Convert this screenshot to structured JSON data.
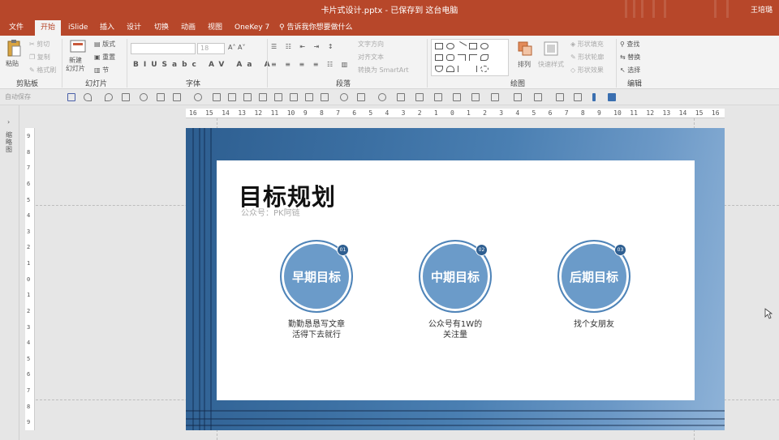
{
  "window": {
    "title": "卡片式设计.pptx - 已保存到 这台电脑",
    "user": "王培璐"
  },
  "tabs": [
    "文件",
    "开始",
    "iSlide",
    "插入",
    "设计",
    "切换",
    "动画",
    "视图",
    "OneKey 7"
  ],
  "active_tab": "开始",
  "tell_me": "告诉我你想要做什么",
  "ribbon": {
    "clipboard": {
      "label": "剪贴板",
      "paste": "粘贴",
      "cut": "剪切",
      "copy": "复制",
      "format_painter": "格式刷"
    },
    "slides": {
      "label": "幻灯片",
      "new_slide": "新建\n幻灯片",
      "layout": "版式",
      "reset": "重置",
      "section": "节"
    },
    "font": {
      "label": "字体",
      "size": "18"
    },
    "paragraph": {
      "label": "段落",
      "text_direction": "文字方向",
      "align_text": "对齐文本",
      "smartart": "转换为 SmartArt"
    },
    "drawing": {
      "label": "绘图",
      "arrange": "排列",
      "quick_styles": "快速样式",
      "shape_fill": "形状填充",
      "shape_outline": "形状轮廓",
      "shape_effects": "形状效果"
    },
    "editing": {
      "label": "编辑",
      "find": "查找",
      "replace": "替换",
      "select": "选择"
    }
  },
  "qat": {
    "autosave": "自动保存"
  },
  "thumbnail_pane": {
    "label": "缩略图"
  },
  "ruler": {
    "h_ticks": [
      "16",
      "15",
      "14",
      "13",
      "12",
      "11",
      "10",
      "9",
      "8",
      "7",
      "6",
      "5",
      "4",
      "3",
      "2",
      "1",
      "0",
      "1",
      "2",
      "3",
      "4",
      "5",
      "6",
      "7",
      "8",
      "9",
      "10",
      "11",
      "12",
      "13",
      "14",
      "15",
      "16"
    ],
    "v_ticks": [
      "9",
      "8",
      "7",
      "6",
      "5",
      "4",
      "3",
      "2",
      "1",
      "0",
      "1",
      "2",
      "3",
      "4",
      "5",
      "6",
      "7",
      "8",
      "9"
    ]
  },
  "slide": {
    "title": "目标规划",
    "subtitle": "公众号：PK阿链",
    "goals": [
      {
        "label": "早期目标",
        "badge": "01",
        "desc": "勤勤恳恳写文章\n活得下去就行"
      },
      {
        "label": "中期目标",
        "badge": "02",
        "desc": "公众号有1W的\n关注量"
      },
      {
        "label": "后期目标",
        "badge": "03",
        "desc": "找个女朋友"
      }
    ],
    "colors": {
      "circle": "#6b9bc9",
      "circle_border": "#4f84b8",
      "badge": "#2f5f91",
      "background": "#3b6fa2"
    }
  }
}
